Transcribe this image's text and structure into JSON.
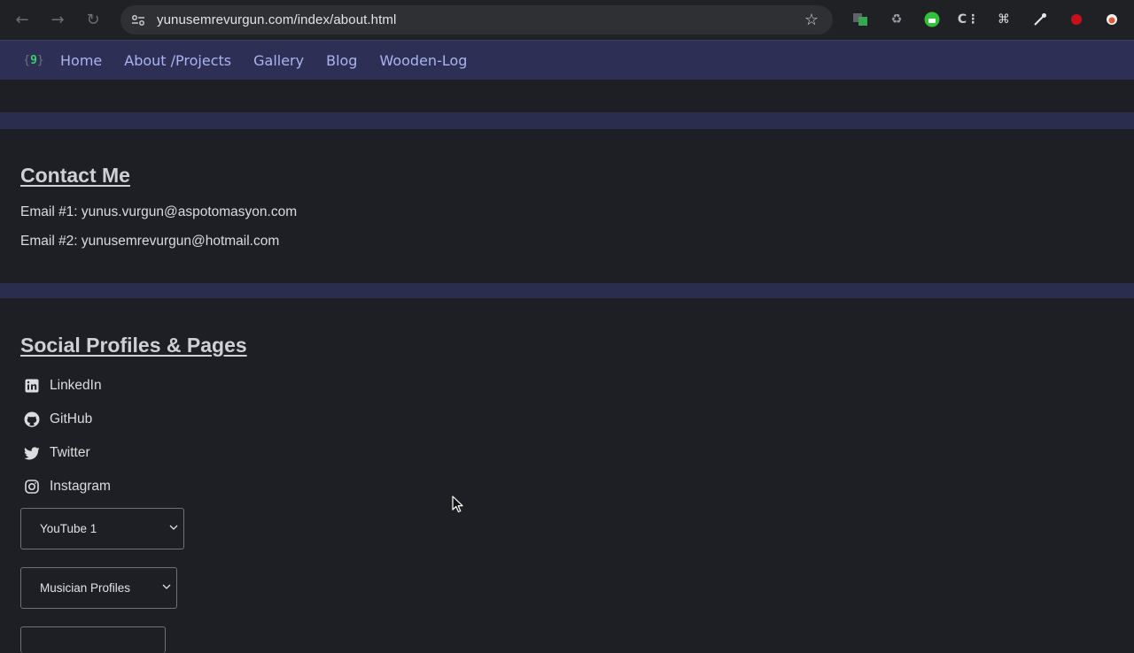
{
  "browser": {
    "url": "yunusemrevurgun.com/index/about.html",
    "back_icon": "back-arrow-icon",
    "forward_icon": "forward-arrow-icon",
    "reload_icon": "reload-icon"
  },
  "site_nav": {
    "links": [
      "Home",
      "About /Projects",
      "Gallery",
      "Blog",
      "Wooden-Log"
    ]
  },
  "contact": {
    "heading": "Contact Me",
    "email1": "Email #1: yunus.vurgun@aspotomasyon.com",
    "email2": "Email #2: yunusemrevurgun@hotmail.com"
  },
  "social": {
    "heading": "Social Profiles & Pages",
    "items": [
      "LinkedIn",
      "GitHub",
      "Twitter",
      "Instagram"
    ],
    "dropdowns": [
      "YouTube 1",
      "Musician Profiles",
      ""
    ]
  },
  "colors": {
    "page_bg": "#1d1f24",
    "nav_bg": "#2d2f55",
    "band": "#2b2d4f",
    "nav_link": "#a9b4f0"
  }
}
